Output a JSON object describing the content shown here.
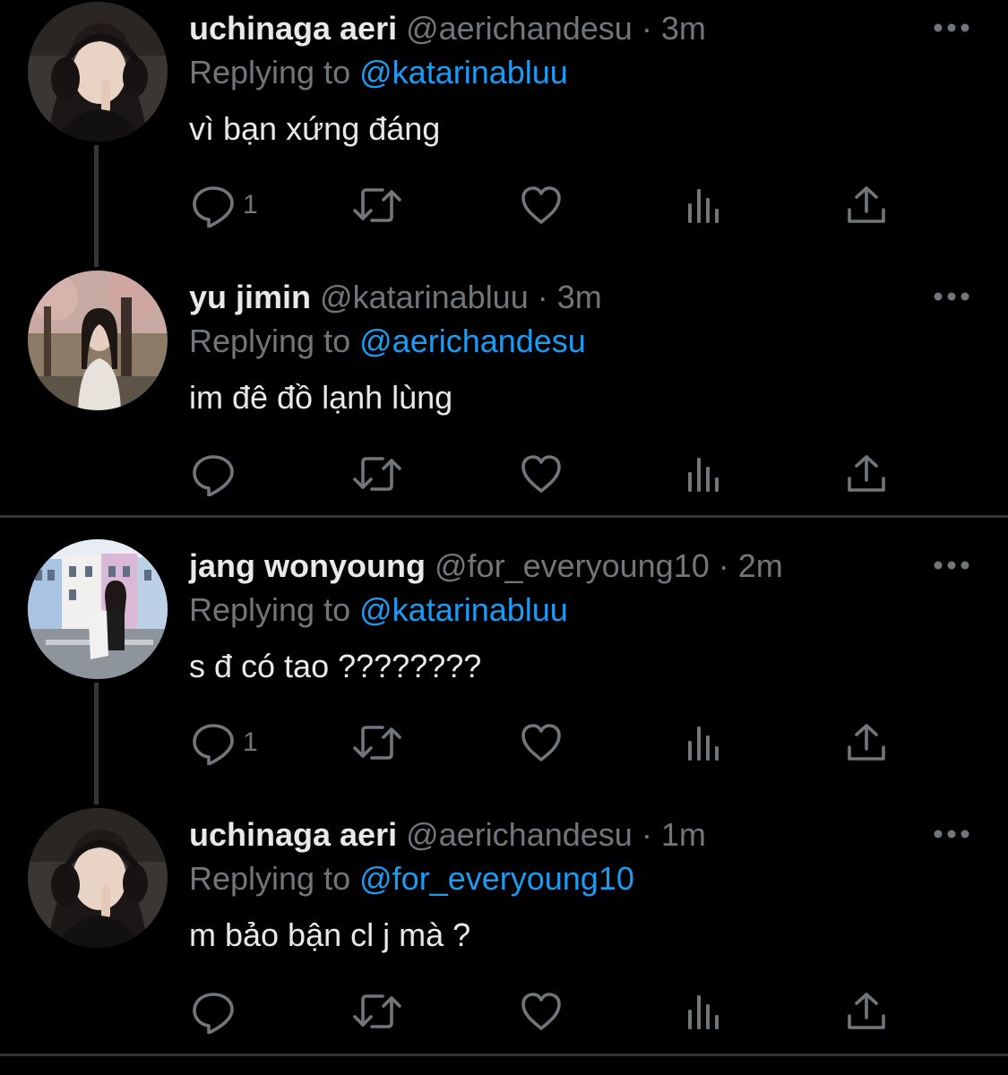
{
  "tweets": [
    {
      "name": "uchinaga aeri",
      "handle": "@aerichandesu",
      "separator": "·",
      "time": "3m",
      "replying_prefix": "Replying to",
      "replying_to": "@katarinabluu",
      "text": "vì bạn xứng đáng",
      "reply_count": "1"
    },
    {
      "name": "yu jimin",
      "handle": "@katarinabluu",
      "separator": "·",
      "time": "3m",
      "replying_prefix": "Replying to",
      "replying_to": "@aerichandesu",
      "text": "im đê đồ lạnh lùng",
      "reply_count": ""
    },
    {
      "name": "jang wonyoung",
      "handle": "@for_everyoung10",
      "separator": "·",
      "time": "2m",
      "replying_prefix": "Replying to",
      "replying_to": "@katarinabluu",
      "text": "s đ có tao ????????",
      "reply_count": "1"
    },
    {
      "name": "uchinaga aeri",
      "handle": "@aerichandesu",
      "separator": "·",
      "time": "1m",
      "replying_prefix": "Replying to",
      "replying_to": "@for_everyoung10",
      "text": "m bảo bận cl j mà ?",
      "reply_count": ""
    }
  ],
  "icons": {
    "reply": "reply-icon",
    "retweet": "retweet-icon",
    "like": "like-icon",
    "views": "views-icon",
    "share": "share-icon",
    "more": "more-icon"
  },
  "colors": {
    "background": "#000000",
    "primary_text": "#e7e9ea",
    "secondary_text": "#71767b",
    "mention": "#1d9bf0",
    "thread_line": "#333639",
    "separator": "#2f3336"
  }
}
